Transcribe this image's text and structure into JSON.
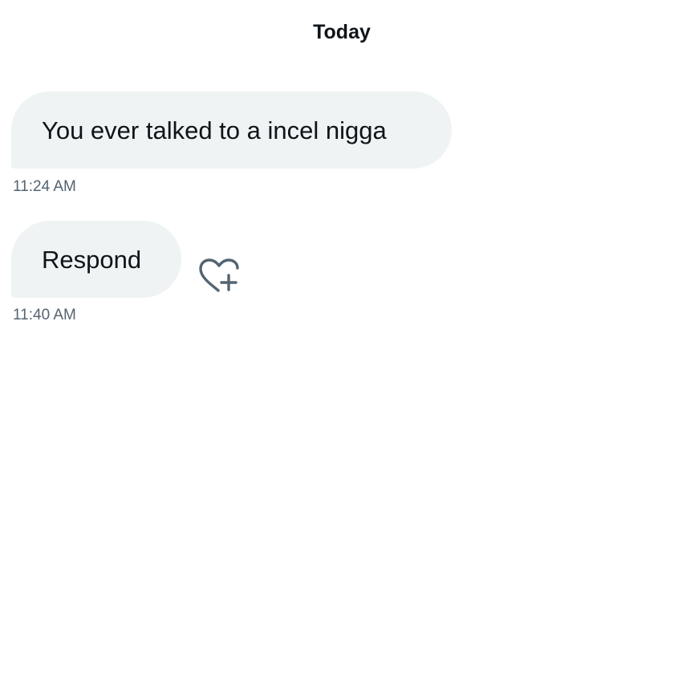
{
  "conversation": {
    "day_label": "Today",
    "messages": [
      {
        "text": "You ever talked to a incel nigga",
        "time": "11:24 AM"
      },
      {
        "text": "Respond",
        "time": "11:40 AM",
        "reaction_icon": "heart-plus-icon"
      }
    ]
  },
  "colors": {
    "bubble_bg": "#eff3f4",
    "text": "#0f1419",
    "timestamp": "#536471",
    "icon": "#536471"
  }
}
